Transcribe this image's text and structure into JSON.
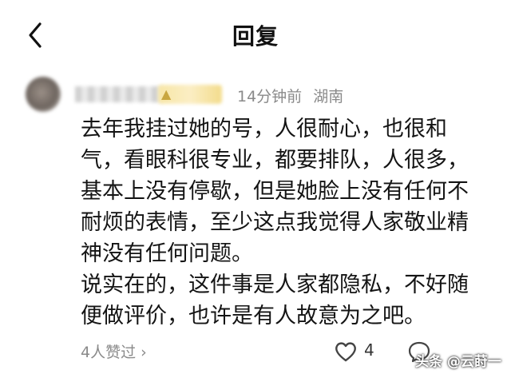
{
  "header": {
    "title": "回复",
    "back_icon": "chevron-left-icon"
  },
  "comment": {
    "time": "14分钟前",
    "location": "湖南",
    "badge_icon": "badge-icon",
    "paragraphs": [
      "去年我挂过她的号，人很耐心，也很和气，看眼科很专业，都要排队，人很多，基本上没有停歇，但是她脸上没有任何不耐烦的表情，至少这点我觉得人家敬业精神没有任何问题。",
      "说实在的，这件事是人家都隐私，不好随便做评价，也许是有人故意为之吧。"
    ]
  },
  "footer": {
    "likes_summary": "4人赞过",
    "chevron": "›",
    "like_count": "4",
    "heart_icon": "heart-outline-icon",
    "reply_icon": "comment-icon"
  },
  "watermark": "头条 @云莳一",
  "colors": {
    "background": "#ffffff",
    "meta_text": "#8a8a8a",
    "body_text": "#141414"
  }
}
